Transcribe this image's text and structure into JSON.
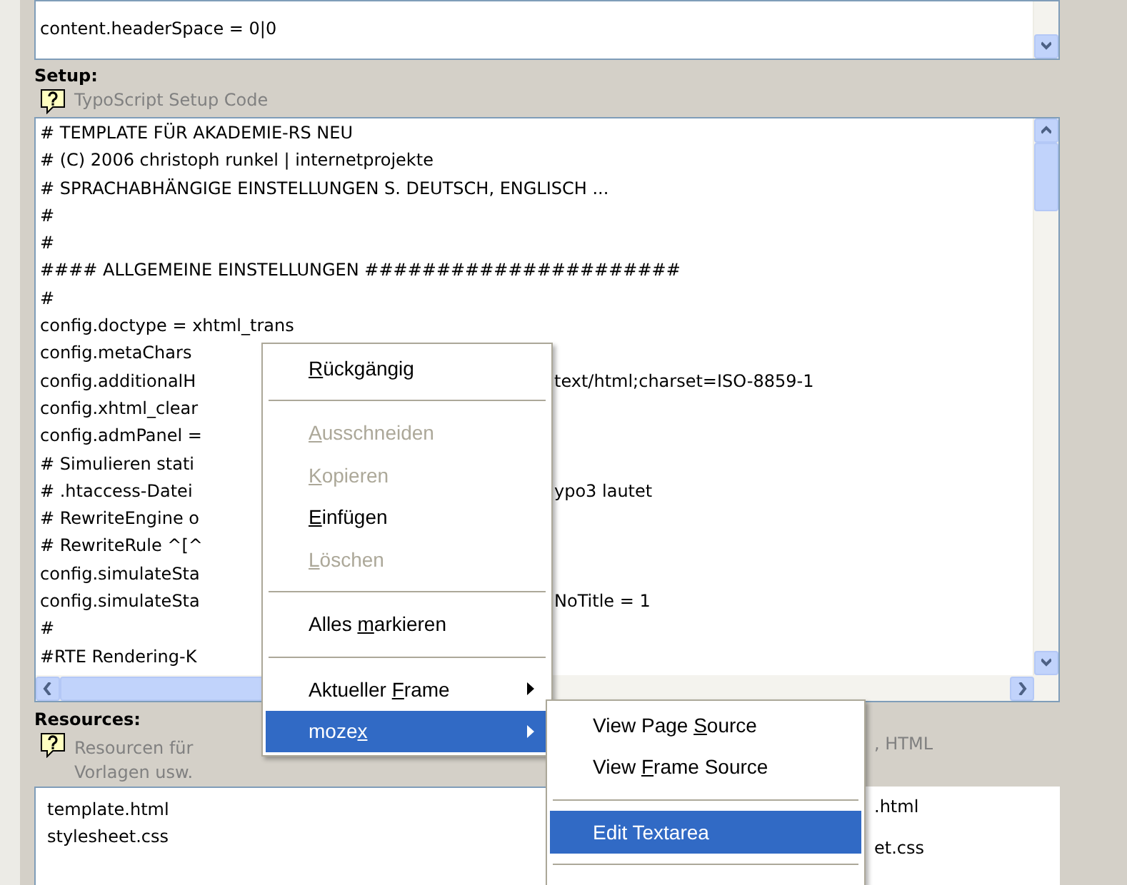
{
  "top_editor": {
    "lines": [
      "content.headerSpace = 0|0"
    ]
  },
  "setup": {
    "title": "Setup:",
    "help": "TypoScript Setup Code",
    "lines": [
      {
        "left": "# TEMPLATE FÜR AKADEMIE-RS NEU"
      },
      {
        "left": "# (C) 2006 christoph runkel | internetprojekte"
      },
      {
        "left": "# SPRACHABHÄNGIGE EINSTELLUNGEN S. DEUTSCH, ENGLISCH ..."
      },
      {
        "left": "#"
      },
      {
        "left": "#"
      },
      {
        "left": "#### ALLGEMEINE EINSTELLUNGEN ######################"
      },
      {
        "left": "#"
      },
      {
        "left": "config.doctype = xhtml_trans"
      },
      {
        "left": "config.metaChars"
      },
      {
        "left": "config.additionalH",
        "right": "text/html;charset=ISO-8859-1"
      },
      {
        "left": "config.xhtml_clear"
      },
      {
        "left": "config.admPanel ="
      },
      {
        "left": "# Simulieren stati"
      },
      {
        "left": "# .htaccess-Datei",
        "right": "ypo3 lautet"
      },
      {
        "left": "# RewriteEngine o"
      },
      {
        "left": "# RewriteRule ^[^"
      },
      {
        "left": "config.simulateSta"
      },
      {
        "left": "config.simulateSta",
        "right": "NoTitle = 1"
      },
      {
        "left": "#"
      },
      {
        "left": "#RTE Rendering-K"
      }
    ]
  },
  "resources": {
    "title": "Resources:",
    "help_left": "Resourcen für",
    "help_right": ", HTML",
    "help_line2": "Vorlagen usw.",
    "files": [
      "template.html",
      "stylesheet.css"
    ],
    "files_right": [
      ".html",
      "et.css"
    ]
  },
  "context_menu": {
    "items": [
      {
        "kind": "item",
        "label": {
          "key": "R",
          "after": "ückgängig"
        },
        "disabled": false,
        "selected": false,
        "submenu": false
      },
      {
        "kind": "separator"
      },
      {
        "kind": "item",
        "label": {
          "key": "A",
          "after": "usschneiden"
        },
        "disabled": true,
        "selected": false,
        "submenu": false
      },
      {
        "kind": "item",
        "label": {
          "key": "K",
          "after": "opieren"
        },
        "disabled": true,
        "selected": false,
        "submenu": false
      },
      {
        "kind": "item",
        "label": {
          "key": "E",
          "after": "infügen"
        },
        "disabled": false,
        "selected": false,
        "submenu": false
      },
      {
        "kind": "item",
        "label": {
          "key": "L",
          "after": "öschen"
        },
        "disabled": true,
        "selected": false,
        "submenu": false
      },
      {
        "kind": "separator"
      },
      {
        "kind": "item",
        "label": {
          "before": "Alles ",
          "key": "m",
          "after": "arkieren"
        },
        "disabled": false,
        "selected": false,
        "submenu": false
      },
      {
        "kind": "separator"
      },
      {
        "kind": "item",
        "label": {
          "before": "Aktueller ",
          "key": "F",
          "after": "rame"
        },
        "disabled": false,
        "selected": false,
        "submenu": true
      },
      {
        "kind": "item",
        "label": {
          "before": "moze",
          "key": "x"
        },
        "disabled": false,
        "selected": true,
        "submenu": true
      }
    ]
  },
  "submenu": {
    "items": [
      {
        "kind": "item",
        "label": {
          "before": "View Page ",
          "key": "S",
          "after": "ource"
        },
        "disabled": false,
        "selected": false,
        "submenu": false
      },
      {
        "kind": "item",
        "label": {
          "before": "View ",
          "key": "F",
          "after": "rame Source"
        },
        "disabled": false,
        "selected": false,
        "submenu": false
      },
      {
        "kind": "separator"
      },
      {
        "kind": "item",
        "label": {
          "before": "Edit Textarea"
        },
        "disabled": false,
        "selected": true,
        "submenu": false
      },
      {
        "kind": "separator"
      }
    ]
  }
}
